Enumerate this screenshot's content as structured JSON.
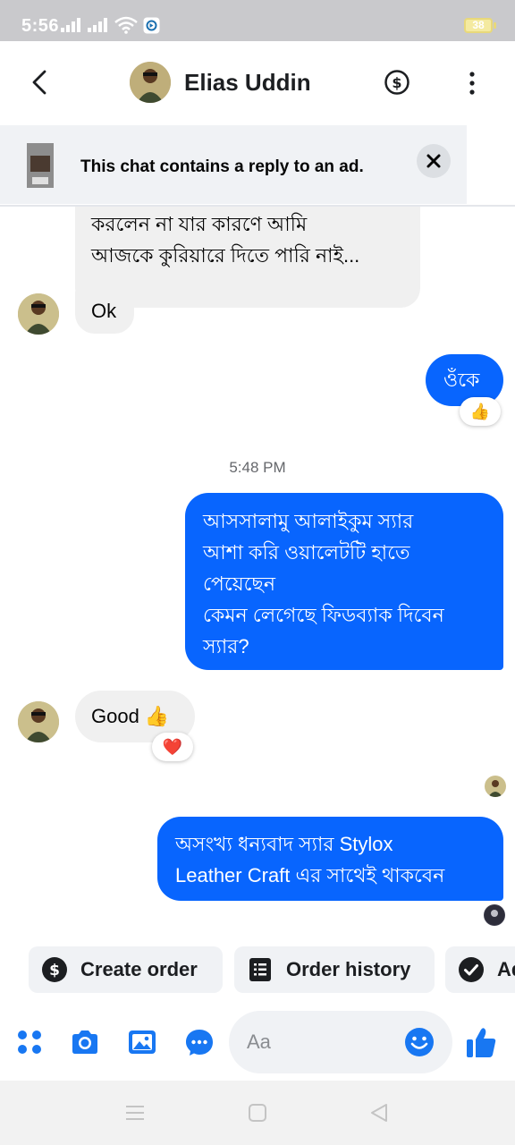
{
  "status_bar": {
    "time": "5:56",
    "battery": "38"
  },
  "header": {
    "contact_name": "Elias Uddin"
  },
  "ad_banner": {
    "text": "This chat contains a reply to an ad."
  },
  "messages": {
    "incoming_1_line1": "করলেন না যার কারণে আমি",
    "incoming_1_line2": "আজকে কুরিয়ারে দিতে পারি নাই...",
    "incoming_2": "Ok",
    "outgoing_1": "ওঁকে",
    "outgoing_1_reaction": "👍",
    "timestamp": "5:48 PM",
    "outgoing_2_lines": [
      "আসসালামু আলাইকুম স্যার",
      "আশা করি ওয়ালেটটি হাতে",
      "পেয়েছেন",
      "কেমন লেগেছে ফিডব্যাক দিবেন",
      "স্যার?"
    ],
    "incoming_3": "Good 👍",
    "incoming_3_reaction": "❤️",
    "outgoing_3_lines": [
      "অসংখ্য ধন্যবাদ স্যার Stylox",
      "Leather Craft এর সাথেই থাকবেন"
    ]
  },
  "quick_replies": {
    "create_order": "Create order",
    "order_history": "Order history",
    "third_partial": "Ad"
  },
  "composer": {
    "placeholder": "Aa"
  },
  "colors": {
    "accent": "#0865fe",
    "incoming_bubble": "#f0f0f0",
    "icon_blue": "#1877f2"
  }
}
